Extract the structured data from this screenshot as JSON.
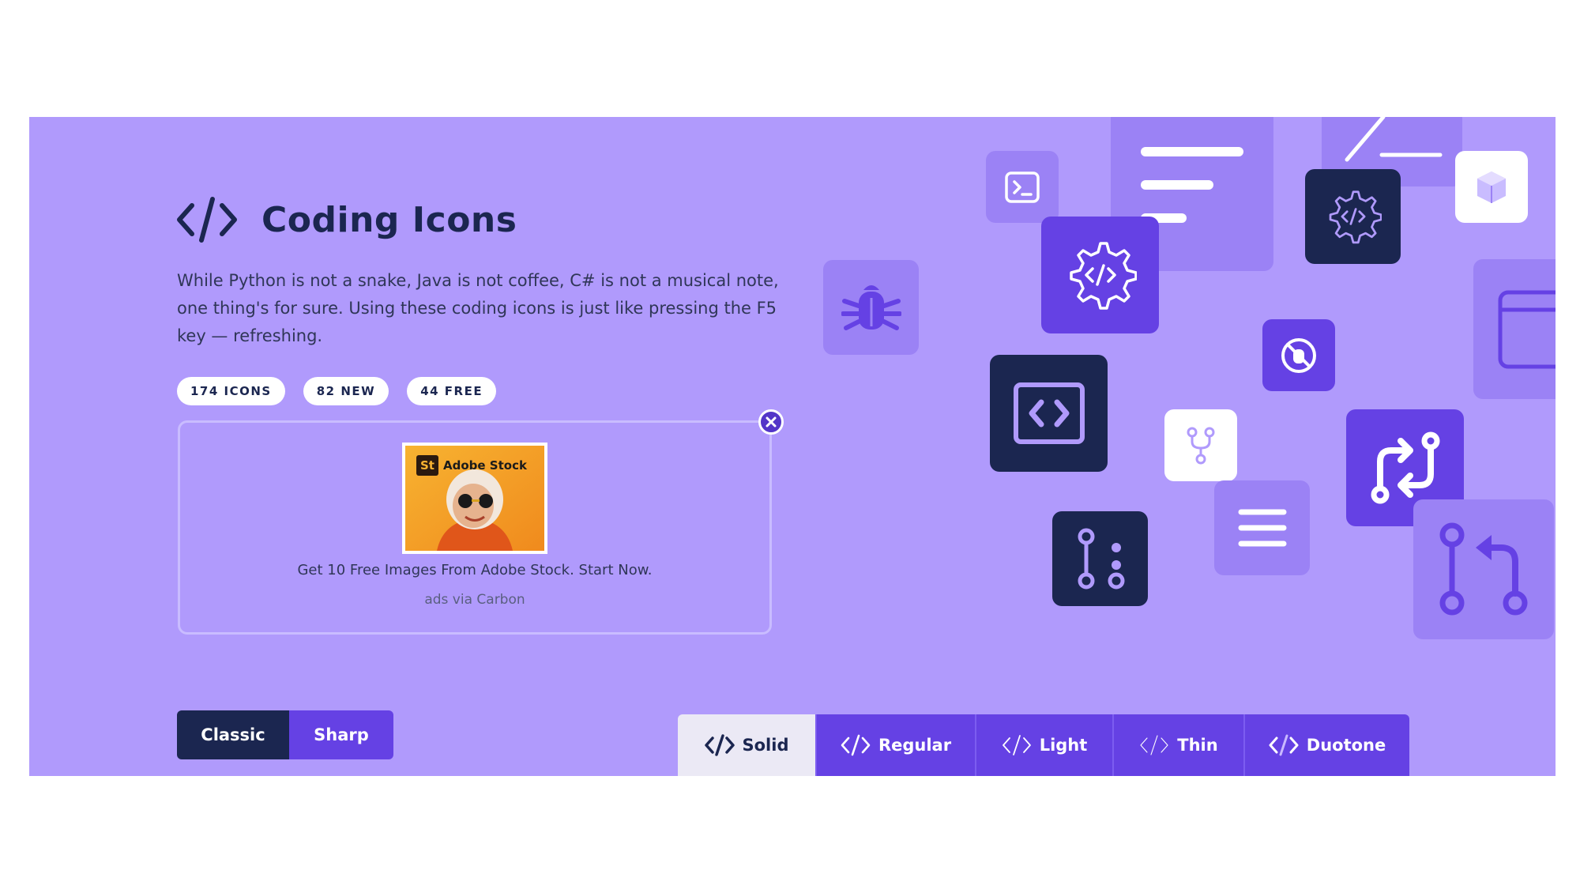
{
  "colors": {
    "hero_bg": "#b09afc",
    "navy": "#1b2650",
    "violet": "#6541e4",
    "deep_violet": "#5335c8",
    "light_violet": "#9b82f5"
  },
  "header": {
    "title": "Coding Icons",
    "title_icon": "code-icon",
    "description": "While Python is not a snake, Java is not coffee, C# is not a musical note, one thing's for sure. Using these coding icons is just like pressing the F5 key — refreshing."
  },
  "badges": [
    "174 ICONS",
    "82 NEW",
    "44 FREE"
  ],
  "ad": {
    "brand_mark": "St",
    "brand_name": "Adobe Stock",
    "text": "Get 10 Free Images From Adobe Stock. Start Now.",
    "via": "ads via Carbon",
    "close_icon": "close-icon"
  },
  "family_toggle": {
    "classic": "Classic",
    "sharp": "Sharp",
    "selected": "Classic"
  },
  "style_tabs": [
    {
      "label": "Solid",
      "icon": "code-icon",
      "active": true
    },
    {
      "label": "Regular",
      "icon": "code-icon",
      "active": false
    },
    {
      "label": "Light",
      "icon": "code-icon",
      "active": false
    },
    {
      "label": "Thin",
      "icon": "code-icon",
      "active": false
    },
    {
      "label": "Duotone",
      "icon": "code-icon",
      "active": false
    }
  ],
  "decorative_icons": [
    "terminal-icon",
    "align-left-icon",
    "slash-icon",
    "gear-code-icon",
    "cube-icon",
    "bug-icon",
    "file-code-icon",
    "window-icon",
    "bug-slash-icon",
    "code-square-icon",
    "code-branch-icon",
    "arrows-repeat-icon",
    "code-pull-request-icon",
    "code-compare-icon",
    "bars-icon"
  ]
}
